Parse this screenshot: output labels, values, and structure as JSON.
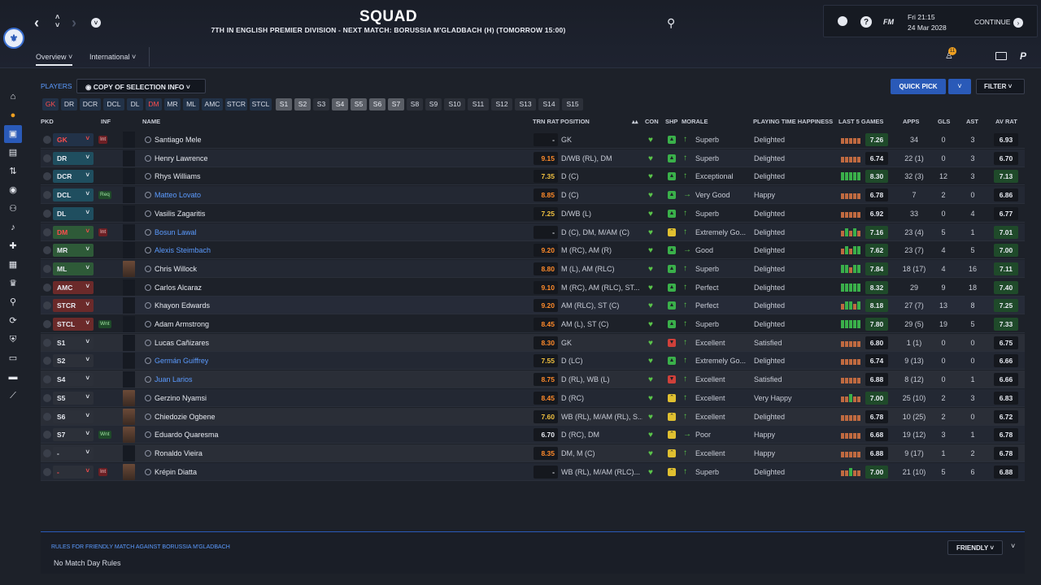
{
  "header": {
    "title": "SQUAD",
    "subtitle": "7TH IN ENGLISH PREMIER DIVISION - NEXT MATCH: BORUSSIA M'GLADBACH (H) (TOMORROW 15:00)",
    "brand": "FM",
    "date_line1": "Fri 21:15",
    "date_line2": "24 Mar 2028",
    "continue_label": "CONTINUE",
    "notification_count": "11"
  },
  "tabs": [
    {
      "label": "Overview ˅"
    },
    {
      "label": "International ˅"
    }
  ],
  "toolbar": {
    "players_label": "PLAYERS",
    "copy_selection": "◉  COPY OF SELECTION INFO  ˅",
    "quick_pick": "QUICK PICK",
    "filter": "FILTER  ˅"
  },
  "chips": [
    {
      "label": "GK",
      "kind": "pos",
      "red": true
    },
    {
      "label": "DR",
      "kind": "pos"
    },
    {
      "label": "DCR",
      "kind": "pos"
    },
    {
      "label": "DCL",
      "kind": "pos"
    },
    {
      "label": "DL",
      "kind": "pos"
    },
    {
      "label": "DM",
      "kind": "pos",
      "red": true
    },
    {
      "label": "MR",
      "kind": "pos"
    },
    {
      "label": "ML",
      "kind": "pos"
    },
    {
      "label": "AMC",
      "kind": "pos"
    },
    {
      "label": "STCR",
      "kind": "pos"
    },
    {
      "label": "STCL",
      "kind": "pos"
    },
    {
      "label": "S1",
      "kind": "sub"
    },
    {
      "label": "S2",
      "kind": "sub"
    },
    {
      "label": "S3",
      "kind": "off"
    },
    {
      "label": "S4",
      "kind": "sub"
    },
    {
      "label": "S5",
      "kind": "sub"
    },
    {
      "label": "S6",
      "kind": "sub"
    },
    {
      "label": "S7",
      "kind": "sub"
    },
    {
      "label": "S8",
      "kind": "off"
    },
    {
      "label": "S9",
      "kind": "off"
    },
    {
      "label": "S10",
      "kind": "off"
    },
    {
      "label": "S11",
      "kind": "off"
    },
    {
      "label": "S12",
      "kind": "off"
    },
    {
      "label": "S13",
      "kind": "off"
    },
    {
      "label": "S14",
      "kind": "off"
    },
    {
      "label": "S15",
      "kind": "off"
    }
  ],
  "columns": {
    "pkd": "PKD",
    "inf": "INF",
    "name": "NAME",
    "trn_rat": "TRN RAT",
    "position": "POSITION",
    "con": "CON",
    "shp": "SHP",
    "morale": "MORALE",
    "pt_happiness": "PLAYING TIME HAPPINESS",
    "last5": "LAST 5 GAMES",
    "apps": "APPS",
    "gls": "GLS",
    "ast": "AST",
    "av_rat": "AV RAT"
  },
  "players": [
    {
      "pkd": "GK",
      "pk": "gk",
      "inf": "Int",
      "name": "Santiago Mele",
      "link": false,
      "photo": false,
      "trn": "-",
      "trnc": "w",
      "position": "GK",
      "shp": "g",
      "morale": "Superb",
      "mor": "up",
      "pt": "Delighted",
      "bars": [
        2,
        2,
        2,
        2,
        2
      ],
      "l5": "7.26",
      "l5g": true,
      "apps": "34",
      "gls": "0",
      "ast": "3",
      "av": "6.93",
      "avg": false
    },
    {
      "pkd": "DR",
      "pk": "def",
      "inf": "",
      "name": "Henry Lawrence",
      "link": false,
      "photo": false,
      "trn": "9.15",
      "trnc": "o",
      "position": "D/WB (RL), DM",
      "shp": "g",
      "morale": "Superb",
      "mor": "up",
      "pt": "Delighted",
      "bars": [
        2,
        2,
        2,
        2,
        2
      ],
      "l5": "6.74",
      "l5g": false,
      "apps": "22 (1)",
      "gls": "0",
      "ast": "3",
      "av": "6.70",
      "avg": false
    },
    {
      "pkd": "DCR",
      "pk": "def",
      "inf": "",
      "name": "Rhys Williams",
      "link": false,
      "photo": false,
      "trn": "7.35",
      "trnc": "y",
      "position": "D (C)",
      "shp": "g",
      "morale": "Exceptional",
      "mor": "up",
      "pt": "Delighted",
      "bars": [
        3,
        3,
        3,
        3,
        3
      ],
      "l5": "8.30",
      "l5g": true,
      "apps": "32 (3)",
      "gls": "12",
      "ast": "3",
      "av": "7.13",
      "avg": true
    },
    {
      "pkd": "DCL",
      "pk": "def",
      "inf": "Req",
      "name": "Matteo Lovato",
      "link": true,
      "photo": false,
      "trn": "8.85",
      "trnc": "o",
      "position": "D (C)",
      "shp": "g",
      "morale": "Very Good",
      "mor": "right",
      "pt": "Happy",
      "bars": [
        2,
        2,
        2,
        2,
        2
      ],
      "l5": "6.78",
      "l5g": false,
      "apps": "7",
      "gls": "2",
      "ast": "0",
      "av": "6.86",
      "avg": false
    },
    {
      "pkd": "DL",
      "pk": "def",
      "inf": "",
      "name": "Vasilis Zagaritis",
      "link": false,
      "photo": false,
      "trn": "7.25",
      "trnc": "y",
      "position": "D/WB (L)",
      "shp": "g",
      "morale": "Superb",
      "mor": "up",
      "pt": "Delighted",
      "bars": [
        2,
        2,
        2,
        2,
        2
      ],
      "l5": "6.92",
      "l5g": false,
      "apps": "33",
      "gls": "0",
      "ast": "4",
      "av": "6.77",
      "avg": false
    },
    {
      "pkd": "DM",
      "pk": "dm",
      "inf": "Int",
      "name": "Bosun Lawal",
      "link": true,
      "photo": false,
      "trn": "-",
      "trnc": "w",
      "position": "D (C), DM, M/AM (C)",
      "shp": "y",
      "morale": "Extremely Go...",
      "mor": "up",
      "pt": "Delighted",
      "bars": [
        2,
        3,
        2,
        3,
        2
      ],
      "l5": "7.16",
      "l5g": true,
      "apps": "23 (4)",
      "gls": "5",
      "ast": "1",
      "av": "7.01",
      "avg": true
    },
    {
      "pkd": "MR",
      "pk": "mid",
      "inf": "",
      "name": "Alexis Steimbach",
      "link": true,
      "photo": false,
      "trn": "9.20",
      "trnc": "o",
      "position": "M (RC), AM (R)",
      "shp": "g",
      "morale": "Good",
      "mor": "right",
      "pt": "Delighted",
      "bars": [
        2,
        3,
        2,
        3,
        3
      ],
      "l5": "7.62",
      "l5g": true,
      "apps": "23 (7)",
      "gls": "4",
      "ast": "5",
      "av": "7.00",
      "avg": true
    },
    {
      "pkd": "ML",
      "pk": "mid",
      "inf": "",
      "name": "Chris Willock",
      "link": false,
      "photo": true,
      "trn": "8.80",
      "trnc": "o",
      "position": "M (L), AM (RLC)",
      "shp": "g",
      "morale": "Superb",
      "mor": "up",
      "pt": "Delighted",
      "bars": [
        3,
        3,
        2,
        3,
        3
      ],
      "l5": "7.84",
      "l5g": true,
      "apps": "18 (17)",
      "gls": "4",
      "ast": "16",
      "av": "7.11",
      "avg": true
    },
    {
      "pkd": "AMC",
      "pk": "att",
      "inf": "",
      "name": "Carlos Alcaraz",
      "link": false,
      "photo": false,
      "trn": "9.10",
      "trnc": "o",
      "position": "M (RC), AM (RLC), ST...",
      "shp": "g",
      "morale": "Perfect",
      "mor": "up",
      "pt": "Delighted",
      "bars": [
        3,
        3,
        3,
        3,
        3
      ],
      "l5": "8.32",
      "l5g": true,
      "apps": "29",
      "gls": "9",
      "ast": "18",
      "av": "7.40",
      "avg": true
    },
    {
      "pkd": "STCR",
      "pk": "att",
      "inf": "",
      "name": "Khayon Edwards",
      "link": false,
      "photo": false,
      "trn": "9.20",
      "trnc": "o",
      "position": "AM (RLC), ST (C)",
      "shp": "g",
      "morale": "Perfect",
      "mor": "up",
      "pt": "Delighted",
      "bars": [
        2,
        3,
        3,
        2,
        3
      ],
      "l5": "8.18",
      "l5g": true,
      "apps": "27 (7)",
      "gls": "13",
      "ast": "8",
      "av": "7.25",
      "avg": true
    },
    {
      "pkd": "STCL",
      "pk": "att",
      "inf": "Wnt",
      "name": "Adam Armstrong",
      "link": false,
      "photo": false,
      "trn": "8.45",
      "trnc": "o",
      "position": "AM (L), ST (C)",
      "shp": "g",
      "morale": "Superb",
      "mor": "up",
      "pt": "Delighted",
      "bars": [
        3,
        3,
        3,
        3,
        3
      ],
      "l5": "7.80",
      "l5g": true,
      "apps": "29 (5)",
      "gls": "19",
      "ast": "5",
      "av": "7.33",
      "avg": true
    },
    {
      "pkd": "S1",
      "pk": "sub",
      "inf": "",
      "name": "Lucas Cañizares",
      "link": false,
      "photo": false,
      "trn": "8.30",
      "trnc": "o",
      "position": "GK",
      "shp": "r",
      "morale": "Excellent",
      "mor": "up",
      "pt": "Satisfied",
      "bars": [
        2,
        2,
        2,
        2,
        2
      ],
      "l5": "6.80",
      "l5g": false,
      "apps": "1 (1)",
      "gls": "0",
      "ast": "0",
      "av": "6.75",
      "avg": false
    },
    {
      "pkd": "S2",
      "pk": "sub",
      "inf": "",
      "name": "Germán Guiffrey",
      "link": true,
      "photo": false,
      "trn": "7.55",
      "trnc": "y",
      "position": "D (LC)",
      "shp": "g",
      "morale": "Extremely Go...",
      "mor": "up",
      "pt": "Delighted",
      "bars": [
        2,
        2,
        2,
        2,
        2
      ],
      "l5": "6.74",
      "l5g": false,
      "apps": "9 (13)",
      "gls": "0",
      "ast": "0",
      "av": "6.66",
      "avg": false
    },
    {
      "pkd": "S4",
      "pk": "sub",
      "inf": "",
      "name": "Juan Larios",
      "link": true,
      "photo": false,
      "trn": "8.75",
      "trnc": "o",
      "position": "D (RL), WB (L)",
      "shp": "r",
      "morale": "Excellent",
      "mor": "up",
      "pt": "Satisfied",
      "bars": [
        2,
        2,
        2,
        2,
        2
      ],
      "l5": "6.88",
      "l5g": false,
      "apps": "8 (12)",
      "gls": "0",
      "ast": "1",
      "av": "6.66",
      "avg": false
    },
    {
      "pkd": "S5",
      "pk": "sub",
      "inf": "",
      "name": "Gerzino Nyamsi",
      "link": false,
      "photo": true,
      "trn": "8.45",
      "trnc": "o",
      "position": "D (RC)",
      "shp": "y",
      "morale": "Excellent",
      "mor": "up",
      "pt": "Very Happy",
      "bars": [
        2,
        2,
        3,
        2,
        2
      ],
      "l5": "7.00",
      "l5g": true,
      "apps": "25 (10)",
      "gls": "2",
      "ast": "3",
      "av": "6.83",
      "avg": false
    },
    {
      "pkd": "S6",
      "pk": "sub",
      "inf": "",
      "name": "Chiedozie Ogbene",
      "link": false,
      "photo": true,
      "trn": "7.60",
      "trnc": "y",
      "position": "WB (RL), M/AM (RL), S...",
      "shp": "y",
      "morale": "Excellent",
      "mor": "up",
      "pt": "Delighted",
      "bars": [
        2,
        2,
        2,
        2,
        2
      ],
      "l5": "6.78",
      "l5g": false,
      "apps": "10 (25)",
      "gls": "2",
      "ast": "0",
      "av": "6.72",
      "avg": false
    },
    {
      "pkd": "S7",
      "pk": "sub",
      "inf": "Wnt",
      "name": "Eduardo Quaresma",
      "link": false,
      "photo": true,
      "trn": "6.70",
      "trnc": "w",
      "position": "D (RC), DM",
      "shp": "y",
      "morale": "Poor",
      "mor": "right",
      "pt": "Happy",
      "bars": [
        2,
        2,
        2,
        2,
        2
      ],
      "l5": "6.68",
      "l5g": false,
      "apps": "19 (12)",
      "gls": "3",
      "ast": "1",
      "av": "6.78",
      "avg": false
    },
    {
      "pkd": "-",
      "pk": "sub",
      "inf": "",
      "name": "Ronaldo Vieira",
      "link": false,
      "photo": false,
      "trn": "8.35",
      "trnc": "o",
      "position": "DM, M (C)",
      "shp": "y",
      "morale": "Excellent",
      "mor": "up",
      "pt": "Happy",
      "bars": [
        2,
        2,
        2,
        2,
        2
      ],
      "l5": "6.88",
      "l5g": false,
      "apps": "9 (17)",
      "gls": "1",
      "ast": "2",
      "av": "6.78",
      "avg": false
    },
    {
      "pkd": "-",
      "pk": "none",
      "inf": "Int",
      "name": "Krépin Diatta",
      "link": false,
      "photo": true,
      "trn": "-",
      "trnc": "w",
      "position": "WB (RL), M/AM (RLC)...",
      "shp": "y",
      "morale": "Superb",
      "mor": "up",
      "pt": "Delighted",
      "bars": [
        2,
        2,
        3,
        2,
        2
      ],
      "l5": "7.00",
      "l5g": true,
      "apps": "21 (10)",
      "gls": "5",
      "ast": "6",
      "av": "6.88",
      "avg": false
    }
  ],
  "rules": {
    "title": "RULES FOR FRIENDLY MATCH AGAINST BORUSSIA M'GLADBACH",
    "body": "No Match Day Rules",
    "friendly_label": "FRIENDLY  ˅"
  },
  "sidebar_icons": [
    "home-icon",
    "inbox-icon",
    "squad-icon",
    "clipboard-icon",
    "transfer-icon",
    "globe-icon",
    "staff-icon",
    "bell-icon",
    "medical-icon",
    "calendar-icon",
    "trophy-icon",
    "search-icon",
    "refresh-icon",
    "club-icon",
    "briefcase-icon",
    "finance-icon",
    "trend-icon"
  ]
}
